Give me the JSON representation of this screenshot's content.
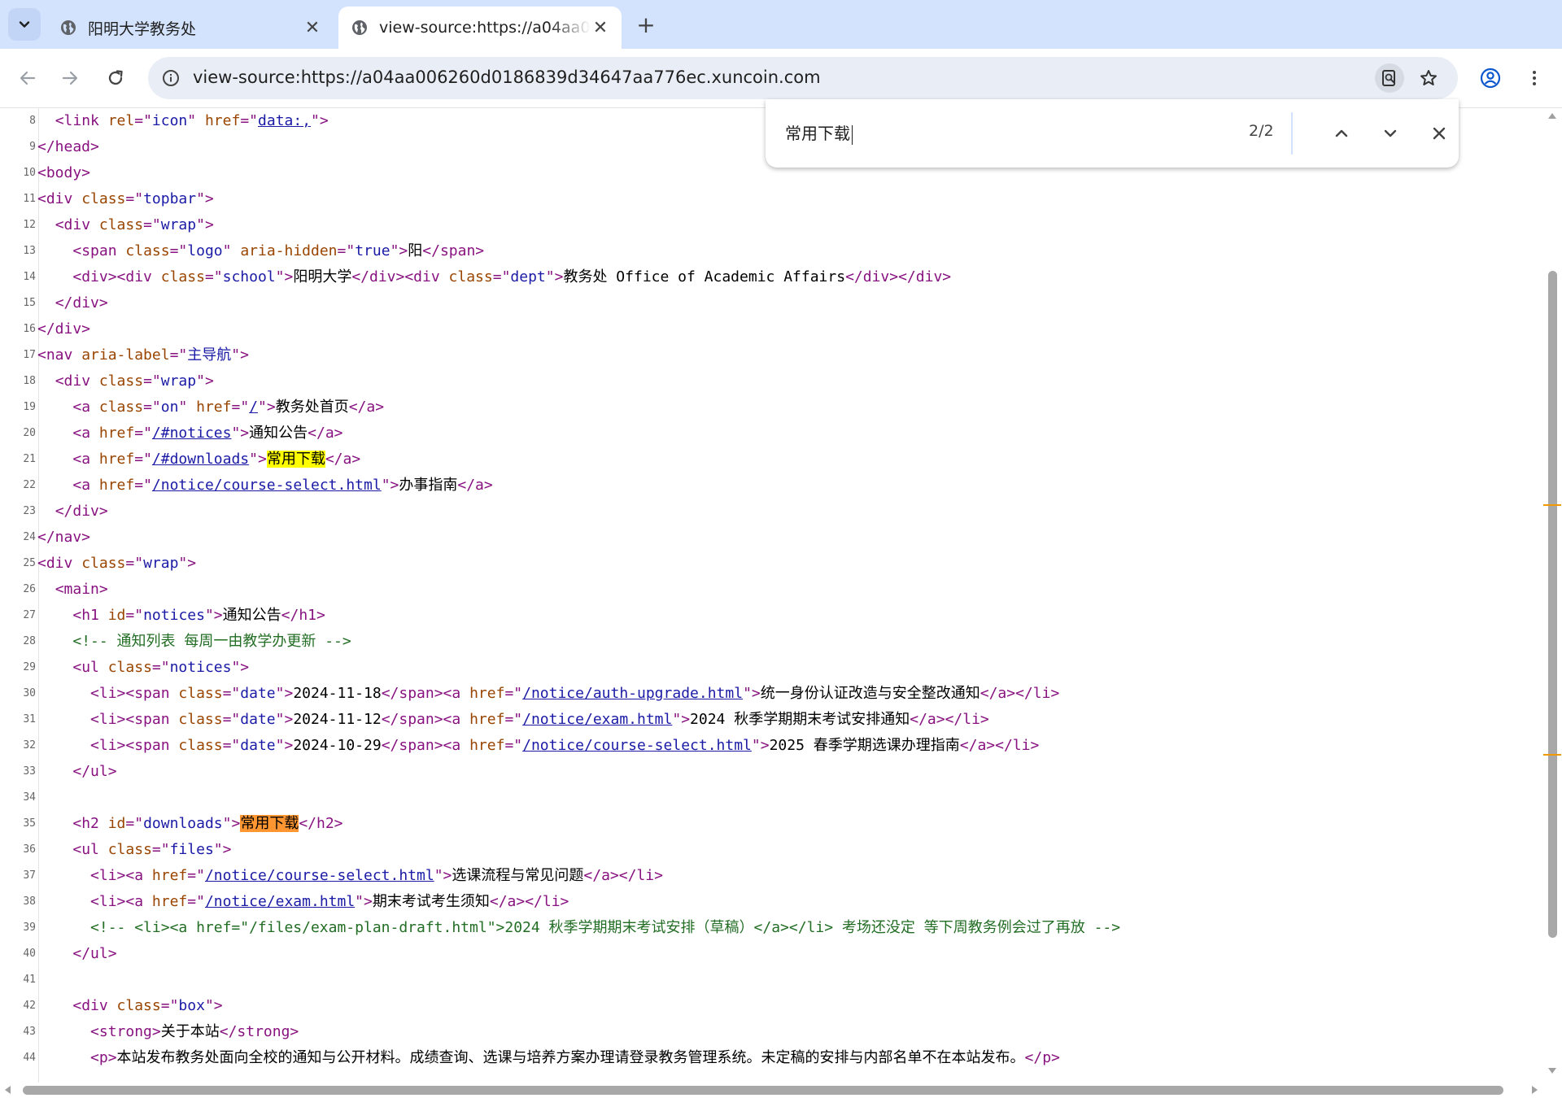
{
  "tabs": [
    {
      "title": "阳明大学教务处",
      "close": "✕",
      "active": false
    },
    {
      "title": "view-source:https://a04aa006260d0186839d34647aa776ec.xuncoin.com",
      "close": "✕",
      "active": true
    }
  ],
  "new_tab": "+",
  "omnibox": {
    "url": "view-source:https://a04aa006260d0186839d34647aa776ec.xuncoin.com"
  },
  "find": {
    "query": "常用下载",
    "count": "2/2"
  },
  "colors": {
    "tab_strip": "#d3e3fd",
    "omnibox": "#e9eef6",
    "tag": "#881280",
    "attr_name": "#994500",
    "attr_value": "#1a1aa6",
    "comment": "#236e25",
    "match": "#ffff00",
    "current_match": "#ff9632"
  },
  "source": {
    "lines": [
      {
        "n": "8",
        "tokens": [
          [
            "",
            "  "
          ],
          [
            "tg",
            "<link "
          ],
          [
            "an",
            "rel"
          ],
          [
            "tg",
            "=\""
          ],
          [
            "av",
            "icon"
          ],
          [
            "tg",
            "\" "
          ],
          [
            "an",
            "href"
          ],
          [
            "tg",
            "=\""
          ],
          [
            "lk",
            "data:,"
          ],
          [
            "tg",
            "\">"
          ]
        ]
      },
      {
        "n": "9",
        "tokens": [
          [
            "tg",
            "</head>"
          ]
        ]
      },
      {
        "n": "10",
        "tokens": [
          [
            "tg",
            "<body>"
          ]
        ]
      },
      {
        "n": "11",
        "tokens": [
          [
            "tg",
            "<div "
          ],
          [
            "an",
            "class"
          ],
          [
            "tg",
            "=\""
          ],
          [
            "av",
            "topbar"
          ],
          [
            "tg",
            "\">"
          ]
        ]
      },
      {
        "n": "12",
        "tokens": [
          [
            "",
            "  "
          ],
          [
            "tg",
            "<div "
          ],
          [
            "an",
            "class"
          ],
          [
            "tg",
            "=\""
          ],
          [
            "av",
            "wrap"
          ],
          [
            "tg",
            "\">"
          ]
        ]
      },
      {
        "n": "13",
        "tokens": [
          [
            "",
            "    "
          ],
          [
            "tg",
            "<span "
          ],
          [
            "an",
            "class"
          ],
          [
            "tg",
            "=\""
          ],
          [
            "av",
            "logo"
          ],
          [
            "tg",
            "\" "
          ],
          [
            "an",
            "aria-hidden"
          ],
          [
            "tg",
            "=\""
          ],
          [
            "av",
            "true"
          ],
          [
            "tg",
            "\">"
          ],
          [
            "",
            "阳"
          ],
          [
            "tg",
            "</span>"
          ]
        ]
      },
      {
        "n": "14",
        "tokens": [
          [
            "",
            "    "
          ],
          [
            "tg",
            "<div><div "
          ],
          [
            "an",
            "class"
          ],
          [
            "tg",
            "=\""
          ],
          [
            "av",
            "school"
          ],
          [
            "tg",
            "\">"
          ],
          [
            "",
            "阳明大学"
          ],
          [
            "tg",
            "</div><div "
          ],
          [
            "an",
            "class"
          ],
          [
            "tg",
            "=\""
          ],
          [
            "av",
            "dept"
          ],
          [
            "tg",
            "\">"
          ],
          [
            "",
            "教务处 Office of Academic Affairs"
          ],
          [
            "tg",
            "</div></div>"
          ]
        ]
      },
      {
        "n": "15",
        "tokens": [
          [
            "",
            "  "
          ],
          [
            "tg",
            "</div>"
          ]
        ]
      },
      {
        "n": "16",
        "tokens": [
          [
            "tg",
            "</div>"
          ]
        ]
      },
      {
        "n": "17",
        "tokens": [
          [
            "tg",
            "<nav "
          ],
          [
            "an",
            "aria-label"
          ],
          [
            "tg",
            "=\""
          ],
          [
            "av",
            "主导航"
          ],
          [
            "tg",
            "\">"
          ]
        ]
      },
      {
        "n": "18",
        "tokens": [
          [
            "",
            "  "
          ],
          [
            "tg",
            "<div "
          ],
          [
            "an",
            "class"
          ],
          [
            "tg",
            "=\""
          ],
          [
            "av",
            "wrap"
          ],
          [
            "tg",
            "\">"
          ]
        ]
      },
      {
        "n": "19",
        "tokens": [
          [
            "",
            "    "
          ],
          [
            "tg",
            "<a "
          ],
          [
            "an",
            "class"
          ],
          [
            "tg",
            "=\""
          ],
          [
            "av",
            "on"
          ],
          [
            "tg",
            "\" "
          ],
          [
            "an",
            "href"
          ],
          [
            "tg",
            "=\""
          ],
          [
            "lk",
            "/"
          ],
          [
            "tg",
            "\">"
          ],
          [
            "",
            "教务处首页"
          ],
          [
            "tg",
            "</a>"
          ]
        ]
      },
      {
        "n": "20",
        "tokens": [
          [
            "",
            "    "
          ],
          [
            "tg",
            "<a "
          ],
          [
            "an",
            "href"
          ],
          [
            "tg",
            "=\""
          ],
          [
            "lk",
            "/#notices"
          ],
          [
            "tg",
            "\">"
          ],
          [
            "",
            "通知公告"
          ],
          [
            "tg",
            "</a>"
          ]
        ]
      },
      {
        "n": "21",
        "tokens": [
          [
            "",
            "    "
          ],
          [
            "tg",
            "<a "
          ],
          [
            "an",
            "href"
          ],
          [
            "tg",
            "=\""
          ],
          [
            "lk",
            "/#downloads"
          ],
          [
            "tg",
            "\">"
          ],
          [
            "hl",
            "常用下载"
          ],
          [
            "tg",
            "</a>"
          ]
        ]
      },
      {
        "n": "22",
        "tokens": [
          [
            "",
            "    "
          ],
          [
            "tg",
            "<a "
          ],
          [
            "an",
            "href"
          ],
          [
            "tg",
            "=\""
          ],
          [
            "lk",
            "/notice/course-select.html"
          ],
          [
            "tg",
            "\">"
          ],
          [
            "",
            "办事指南"
          ],
          [
            "tg",
            "</a>"
          ]
        ]
      },
      {
        "n": "23",
        "tokens": [
          [
            "",
            "  "
          ],
          [
            "tg",
            "</div>"
          ]
        ]
      },
      {
        "n": "24",
        "tokens": [
          [
            "tg",
            "</nav>"
          ]
        ]
      },
      {
        "n": "25",
        "tokens": [
          [
            "tg",
            "<div "
          ],
          [
            "an",
            "class"
          ],
          [
            "tg",
            "=\""
          ],
          [
            "av",
            "wrap"
          ],
          [
            "tg",
            "\">"
          ]
        ]
      },
      {
        "n": "26",
        "tokens": [
          [
            "",
            "  "
          ],
          [
            "tg",
            "<main>"
          ]
        ]
      },
      {
        "n": "27",
        "tokens": [
          [
            "",
            "    "
          ],
          [
            "tg",
            "<h1 "
          ],
          [
            "an",
            "id"
          ],
          [
            "tg",
            "=\""
          ],
          [
            "av",
            "notices"
          ],
          [
            "tg",
            "\">"
          ],
          [
            "",
            "通知公告"
          ],
          [
            "tg",
            "</h1>"
          ]
        ]
      },
      {
        "n": "28",
        "tokens": [
          [
            "",
            "    "
          ],
          [
            "cm",
            "<!-- 通知列表 每周一由教学办更新 -->"
          ]
        ]
      },
      {
        "n": "29",
        "tokens": [
          [
            "",
            "    "
          ],
          [
            "tg",
            "<ul "
          ],
          [
            "an",
            "class"
          ],
          [
            "tg",
            "=\""
          ],
          [
            "av",
            "notices"
          ],
          [
            "tg",
            "\">"
          ]
        ]
      },
      {
        "n": "30",
        "tokens": [
          [
            "",
            "      "
          ],
          [
            "tg",
            "<li><span "
          ],
          [
            "an",
            "class"
          ],
          [
            "tg",
            "=\""
          ],
          [
            "av",
            "date"
          ],
          [
            "tg",
            "\">"
          ],
          [
            "",
            "2024-11-18"
          ],
          [
            "tg",
            "</span><a "
          ],
          [
            "an",
            "href"
          ],
          [
            "tg",
            "=\""
          ],
          [
            "lk",
            "/notice/auth-upgrade.html"
          ],
          [
            "tg",
            "\">"
          ],
          [
            "",
            "统一身份认证改造与安全整改通知"
          ],
          [
            "tg",
            "</a></li>"
          ]
        ]
      },
      {
        "n": "31",
        "tokens": [
          [
            "",
            "      "
          ],
          [
            "tg",
            "<li><span "
          ],
          [
            "an",
            "class"
          ],
          [
            "tg",
            "=\""
          ],
          [
            "av",
            "date"
          ],
          [
            "tg",
            "\">"
          ],
          [
            "",
            "2024-11-12"
          ],
          [
            "tg",
            "</span><a "
          ],
          [
            "an",
            "href"
          ],
          [
            "tg",
            "=\""
          ],
          [
            "lk",
            "/notice/exam.html"
          ],
          [
            "tg",
            "\">"
          ],
          [
            "",
            "2024 秋季学期期末考试安排通知"
          ],
          [
            "tg",
            "</a></li>"
          ]
        ]
      },
      {
        "n": "32",
        "tokens": [
          [
            "",
            "      "
          ],
          [
            "tg",
            "<li><span "
          ],
          [
            "an",
            "class"
          ],
          [
            "tg",
            "=\""
          ],
          [
            "av",
            "date"
          ],
          [
            "tg",
            "\">"
          ],
          [
            "",
            "2024-10-29"
          ],
          [
            "tg",
            "</span><a "
          ],
          [
            "an",
            "href"
          ],
          [
            "tg",
            "=\""
          ],
          [
            "lk",
            "/notice/course-select.html"
          ],
          [
            "tg",
            "\">"
          ],
          [
            "",
            "2025 春季学期选课办理指南"
          ],
          [
            "tg",
            "</a></li>"
          ]
        ]
      },
      {
        "n": "33",
        "tokens": [
          [
            "",
            "    "
          ],
          [
            "tg",
            "</ul>"
          ]
        ]
      },
      {
        "n": "34",
        "tokens": []
      },
      {
        "n": "35",
        "tokens": [
          [
            "",
            "    "
          ],
          [
            "tg",
            "<h2 "
          ],
          [
            "an",
            "id"
          ],
          [
            "tg",
            "=\""
          ],
          [
            "av",
            "downloads"
          ],
          [
            "tg",
            "\">"
          ],
          [
            "hlc",
            "常用下载"
          ],
          [
            "tg",
            "</h2>"
          ]
        ]
      },
      {
        "n": "36",
        "tokens": [
          [
            "",
            "    "
          ],
          [
            "tg",
            "<ul "
          ],
          [
            "an",
            "class"
          ],
          [
            "tg",
            "=\""
          ],
          [
            "av",
            "files"
          ],
          [
            "tg",
            "\">"
          ]
        ]
      },
      {
        "n": "37",
        "tokens": [
          [
            "",
            "      "
          ],
          [
            "tg",
            "<li><a "
          ],
          [
            "an",
            "href"
          ],
          [
            "tg",
            "=\""
          ],
          [
            "lk",
            "/notice/course-select.html"
          ],
          [
            "tg",
            "\">"
          ],
          [
            "",
            "选课流程与常见问题"
          ],
          [
            "tg",
            "</a></li>"
          ]
        ]
      },
      {
        "n": "38",
        "tokens": [
          [
            "",
            "      "
          ],
          [
            "tg",
            "<li><a "
          ],
          [
            "an",
            "href"
          ],
          [
            "tg",
            "=\""
          ],
          [
            "lk",
            "/notice/exam.html"
          ],
          [
            "tg",
            "\">"
          ],
          [
            "",
            "期末考试考生须知"
          ],
          [
            "tg",
            "</a></li>"
          ]
        ]
      },
      {
        "n": "39",
        "tokens": [
          [
            "",
            "      "
          ],
          [
            "cm",
            "<!-- <li><a href=\"/files/exam-plan-draft.html\">2024 秋季学期期末考试安排（草稿）</a></li> 考场还没定 等下周教务例会过了再放 -->"
          ]
        ]
      },
      {
        "n": "40",
        "tokens": [
          [
            "",
            "    "
          ],
          [
            "tg",
            "</ul>"
          ]
        ]
      },
      {
        "n": "41",
        "tokens": []
      },
      {
        "n": "42",
        "tokens": [
          [
            "",
            "    "
          ],
          [
            "tg",
            "<div "
          ],
          [
            "an",
            "class"
          ],
          [
            "tg",
            "=\""
          ],
          [
            "av",
            "box"
          ],
          [
            "tg",
            "\">"
          ]
        ]
      },
      {
        "n": "43",
        "tokens": [
          [
            "",
            "      "
          ],
          [
            "tg",
            "<strong>"
          ],
          [
            "",
            "关于本站"
          ],
          [
            "tg",
            "</strong>"
          ]
        ]
      },
      {
        "n": "44",
        "tokens": [
          [
            "",
            "      "
          ],
          [
            "tg",
            "<p>"
          ],
          [
            "",
            "本站发布教务处面向全校的通知与公开材料。成绩查询、选课与培养方案办理请登录教务管理系统。未定稿的安排与内部名单不在本站发布。"
          ],
          [
            "tg",
            "</p>"
          ]
        ]
      }
    ]
  }
}
